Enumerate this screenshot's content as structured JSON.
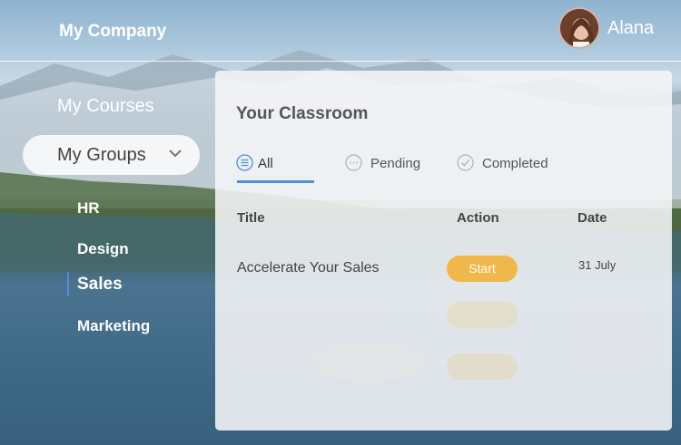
{
  "header": {
    "company": "My Company",
    "user_name": "Alana",
    "avatar_icon": "user-avatar"
  },
  "sidebar": {
    "my_courses": "My Courses",
    "my_groups": "My Groups",
    "groups": [
      "HR",
      "Design",
      "Sales",
      "Marketing"
    ],
    "active_group": "Sales"
  },
  "classroom": {
    "title": "Your Classroom",
    "tabs": [
      {
        "label": "All",
        "icon": "list-icon",
        "active": true
      },
      {
        "label": "Pending",
        "icon": "ellipsis-circle-icon",
        "active": false
      },
      {
        "label": "Completed",
        "icon": "check-circle-icon",
        "active": false
      }
    ],
    "columns": [
      "Title",
      "Action",
      "Date"
    ],
    "rows": [
      {
        "title": "Accelerate Your Sales",
        "action": "Start",
        "date": "31 July"
      }
    ]
  },
  "colors": {
    "accent": "#4f8fd8",
    "start_button": "#f0b84a"
  }
}
